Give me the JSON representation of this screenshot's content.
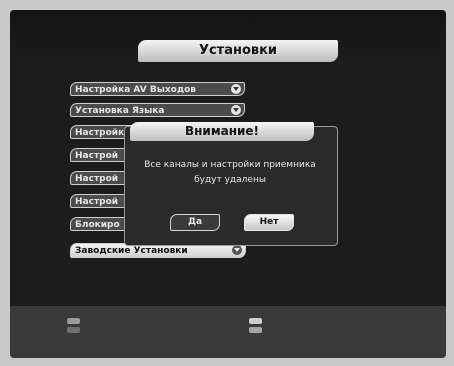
{
  "header": {
    "title": "Установки"
  },
  "menu": {
    "items": [
      {
        "label": "Настройка AV Выходов"
      },
      {
        "label": "Установка Языка"
      },
      {
        "label": "Настройк"
      },
      {
        "label": "Настрой"
      },
      {
        "label": "Настрой"
      },
      {
        "label": "Настрой"
      },
      {
        "label": "Блокиро"
      },
      {
        "label": "Заводские Установки"
      }
    ]
  },
  "dialog": {
    "title": "Внимание!",
    "message_line1": "Все каналы и настройки приемника",
    "message_line2": "будут удалены",
    "yes_label": "Да",
    "no_label": "Нет"
  }
}
